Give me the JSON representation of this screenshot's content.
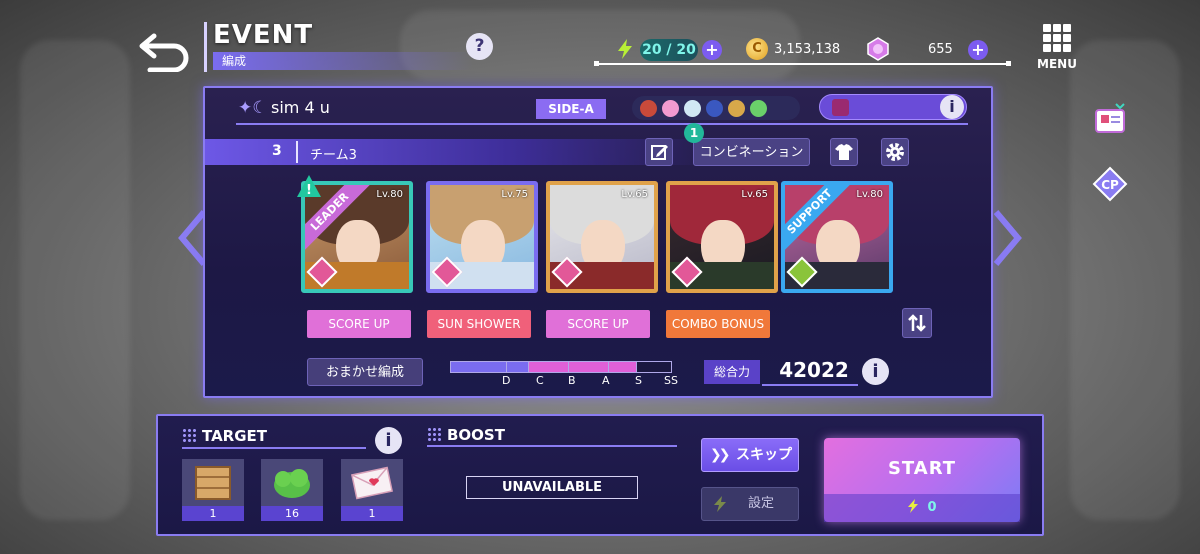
{
  "header": {
    "title": "EVENT",
    "subtitle": "編成",
    "menu_label": "MENU",
    "help_glyph": "?"
  },
  "resources": {
    "energy": "20 / 20",
    "coins": "3,153,138",
    "gems": "655",
    "plus_glyph": "+",
    "coin_glyph": "C"
  },
  "deck": {
    "name": "sim 4 u",
    "side": "SIDE-A",
    "info_glyph": "i"
  },
  "team": {
    "number": "3",
    "name": "チーム3",
    "combination_label": "コンビネーション",
    "combination_badge": "1"
  },
  "cards": [
    {
      "level": "Lv.80",
      "ribbon": "LEADER",
      "skill": "SCORE UP",
      "attribute": "pink"
    },
    {
      "level": "Lv.75",
      "ribbon": "",
      "skill": "SUN SHOWER",
      "attribute": "pink"
    },
    {
      "level": "Lv.65",
      "ribbon": "",
      "skill": "SCORE UP",
      "attribute": "pink"
    },
    {
      "level": "Lv.65",
      "ribbon": "",
      "skill": "COMBO BONUS",
      "attribute": "pink"
    },
    {
      "level": "Lv.80",
      "ribbon": "SUPPORT",
      "skill": "",
      "attribute": "green"
    }
  ],
  "auto_label": "おまかせ編成",
  "rank": {
    "labels": [
      "D",
      "C",
      "B",
      "A",
      "S",
      "SS"
    ],
    "progress": 0.85
  },
  "power": {
    "label": "総合力",
    "value": "42022"
  },
  "target": {
    "title": "TARGET",
    "items": [
      {
        "icon": "wooden-crate-icon",
        "count": "1"
      },
      {
        "icon": "green-bush-icon",
        "count": "16"
      },
      {
        "icon": "love-letter-icon",
        "count": "1"
      }
    ]
  },
  "boost": {
    "title": "BOOST",
    "status": "UNAVAILABLE"
  },
  "actions": {
    "skip_label": "スキップ",
    "settings_label": "設定",
    "start_label": "START",
    "start_cost": "0"
  },
  "side_buttons": {
    "cp_label": "CP"
  },
  "colors": {
    "accent": "#8a7cf2",
    "energy": "#7ff5ea",
    "skill_pink": "#e070d8",
    "skill_coral": "#f0607a",
    "skill_orange": "#f0783a"
  }
}
